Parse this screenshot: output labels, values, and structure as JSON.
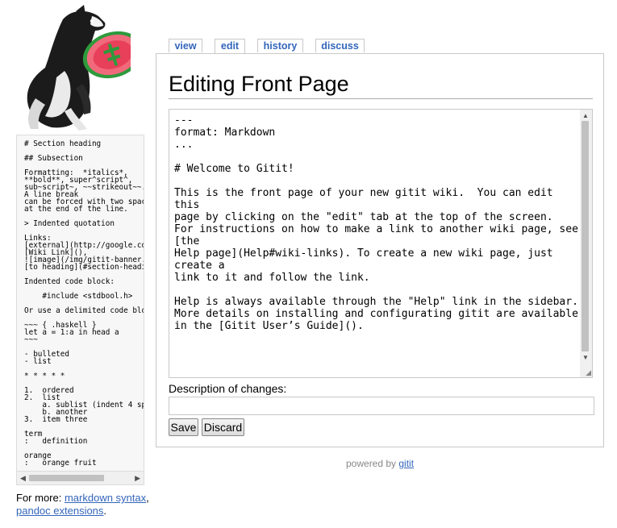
{
  "tabs": [
    {
      "label": "view"
    },
    {
      "label": "edit"
    },
    {
      "label": "history"
    },
    {
      "label": "discuss"
    }
  ],
  "page_title": "Editing Front Page",
  "editor_content": "---\nformat: Markdown\n...\n\n# Welcome to Gitit!\n\nThis is the front page of your new gitit wiki.  You can edit this\npage by clicking on the \"edit\" tab at the top of the screen.\nFor instructions on how to make a link to another wiki page, see [the\nHelp page](Help#wiki-links). To create a new wiki page, just create a\nlink to it and follow the link.\n\nHelp is always available through the \"Help\" link in the sidebar.\nMore details on installing and configurating gitit are available\nin the [Gitit User’s Guide]().",
  "description_label": "Description of changes:",
  "description_value": "",
  "buttons": {
    "save": "Save",
    "discard": "Discard"
  },
  "cheatsheet": "# Section heading\n\n## Subsection\n\nFormatting:  *italics*,\n**bold**, super^script^,\nsub~script~, ~~strikeout~~.\nA line break\ncan be forced with two spaces\nat the end of the line.\n\n> Indented quotation\n\nLinks:\n[external](http://google.com),\n[Wiki Link](),\n![image](/img/gitit-banner.png),\n[to heading](#section-heading)\n\nIndented code block:\n\n    #include <stdbool.h>\n\nOr use a delimited code block:\n\n~~~ { .haskell }\nlet a = 1:a in head a\n~~~\n\n- bulleted\n- list\n\n* * * * *\n\n1.  ordered\n2.  list\n    a. sublist (indent 4 spaces)\n    b. another\n3.  item three\n\nterm\n:   definition\n\norange\n:   orange fruit",
  "more": {
    "prefix": "For more: ",
    "link1": "markdown syntax",
    "separator": ", ",
    "link2": "pandoc extensions",
    "suffix": "."
  },
  "footer": {
    "prefix": "powered by ",
    "link": "gitit"
  },
  "colors": {
    "link": "#3366bb",
    "border": "#c8c8c8",
    "frisbee": "#e8405a"
  }
}
